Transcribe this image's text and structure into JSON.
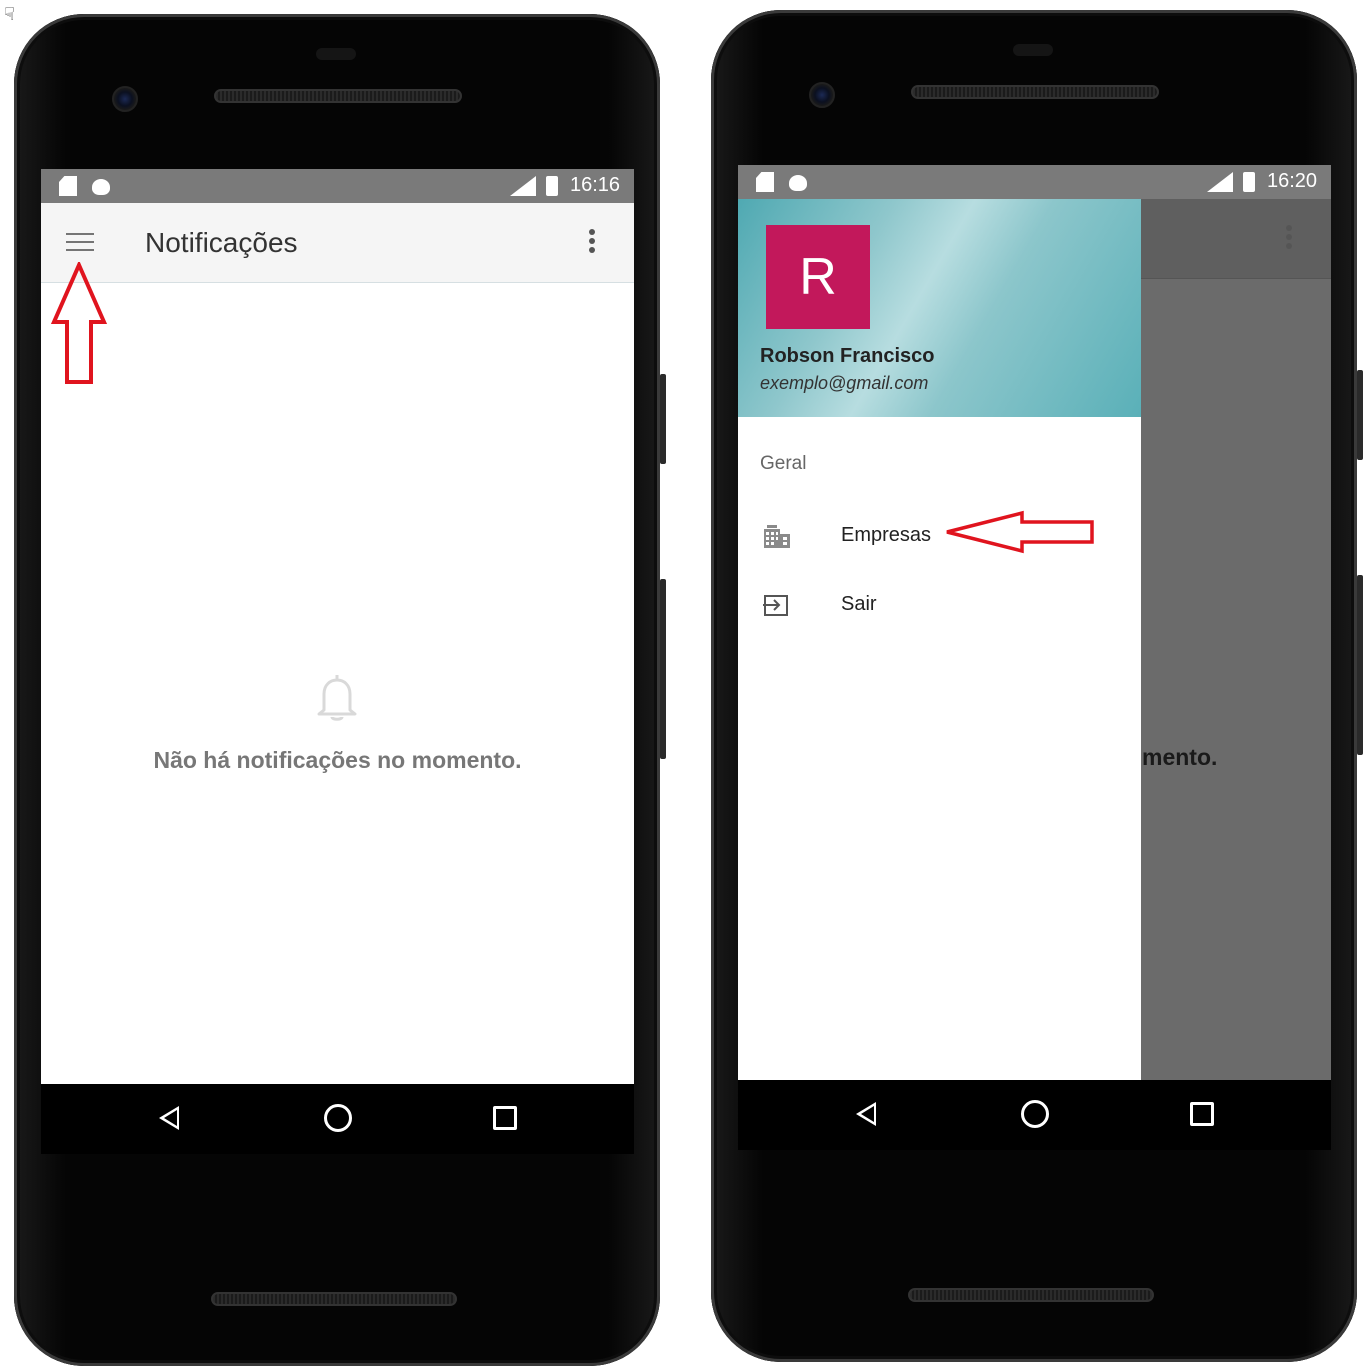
{
  "cursor": "☟",
  "left_phone": {
    "status": {
      "time": "16:16"
    },
    "appbar": {
      "title": "Notificações"
    },
    "empty_state": {
      "message": "Não há notificações no momento."
    }
  },
  "right_phone": {
    "status": {
      "time": "16:20"
    },
    "drawer": {
      "avatar_letter": "R",
      "avatar_color": "#c2185b",
      "user_name": "Robson Francisco",
      "user_email": "exemplo@gmail.com",
      "section_label": "Geral",
      "items": [
        {
          "label": "Empresas",
          "icon": "building-icon"
        },
        {
          "label": "Sair",
          "icon": "exit-icon"
        }
      ]
    },
    "background_text": "mento."
  },
  "colors": {
    "status_bar": "#7a7a7a",
    "annotation_red": "#e0141e",
    "header_teal": "#5ab0b8"
  }
}
